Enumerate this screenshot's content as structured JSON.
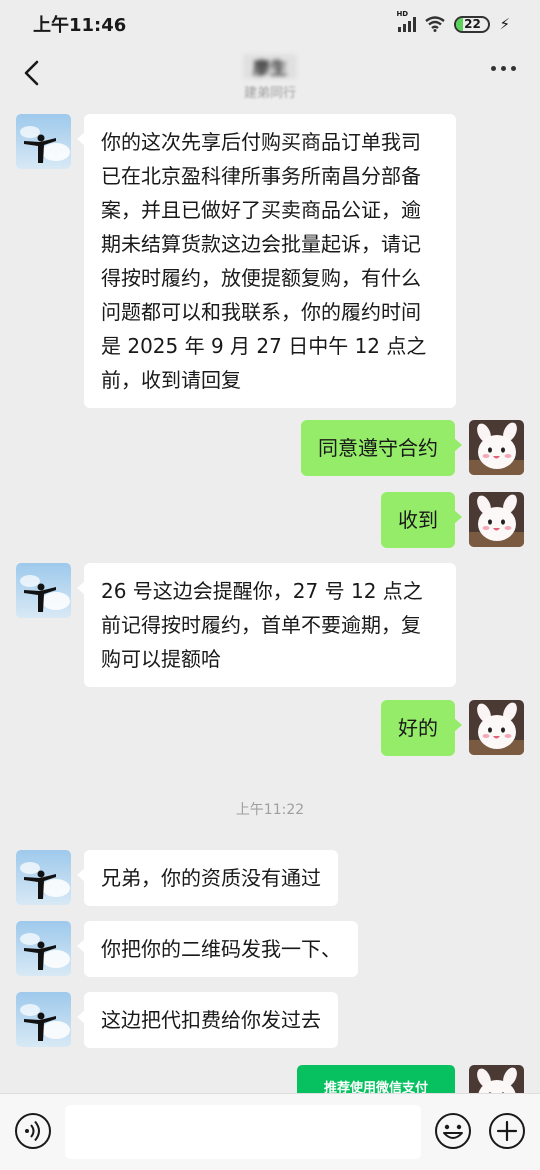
{
  "status": {
    "time": "上午11:46",
    "network": "HD",
    "battery": "22",
    "battery_level": 0.22
  },
  "header": {
    "contact_name": "廖生",
    "subtitle": "建弟同行"
  },
  "messages": [
    {
      "side": "in",
      "text": "你的这次先享后付购买商品订单我司已在北京盈科律所事务所南昌分部备案，并且已做好了买卖商品公证，逾期未结算货款这边会批量起诉，请记得按时履约，放便提额复购，有什么问题都可以和我联系，你的履约时间是 2025 年 9 月 27 日中午 12 点之前，收到请回复"
    },
    {
      "side": "out",
      "text": "同意遵守合约"
    },
    {
      "side": "out",
      "text": "收到"
    },
    {
      "side": "in",
      "text": "26 号这边会提醒你，27 号 12 点之前记得按时履约，首单不要逾期，复购可以提额哈"
    },
    {
      "side": "out",
      "text": "好的"
    },
    {
      "side": "in",
      "text": "兄弟，你的资质没有通过"
    },
    {
      "side": "in",
      "text": "你把你的二维码发我一下、"
    },
    {
      "side": "in",
      "text": "这边把代扣费给你发过去"
    }
  ],
  "timestamp": "上午11:22",
  "pay_card": {
    "label": "推荐使用微信支付"
  },
  "input": {
    "placeholder": ""
  },
  "colors": {
    "background": "#ededed",
    "incoming_bubble": "#ffffff",
    "outgoing_bubble": "#95ec69",
    "pay_green": "#07c160"
  },
  "icons": {
    "back": "chevron-left-icon",
    "more": "more-dots-icon",
    "voice": "voice-icon",
    "emoji": "emoji-icon",
    "plus": "plus-icon"
  }
}
